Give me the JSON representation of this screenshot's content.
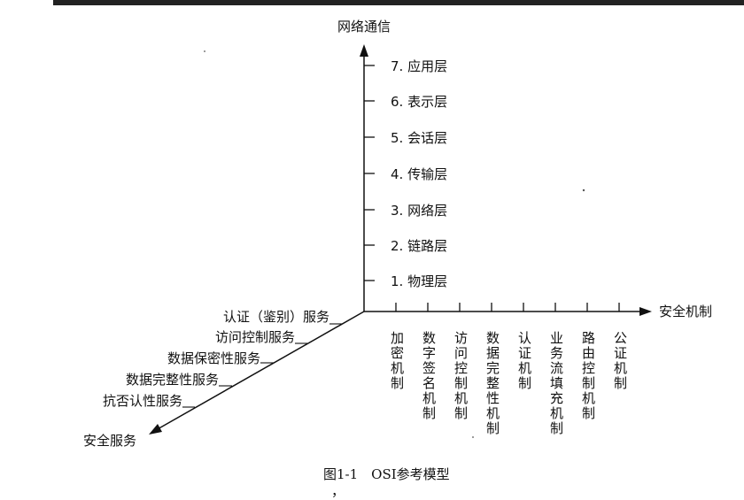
{
  "diagram": {
    "top_partial_text": "……………………………",
    "y_axis_label": "网络通信",
    "x_axis_label": "安全机制",
    "z_axis_label": "安全服务",
    "layers": [
      "1. 物理层",
      "2. 链路层",
      "3. 网络层",
      "4. 传输层",
      "5. 会话层",
      "6. 表示层",
      "7. 应用层"
    ],
    "mechanisms": [
      "加密机制",
      "数字签名机制",
      "访问控制机制",
      "数据完整性机制",
      "认证机制",
      "业务流填充机制",
      "路由控制机制",
      "公证机制"
    ],
    "services": [
      "认证（鉴别）服务",
      "访问控制服务",
      "数据保密性服务",
      "数据完整性服务",
      "抗否认性服务"
    ],
    "caption": "图1-1　OSI参考模型",
    "stray_mark": "，"
  }
}
